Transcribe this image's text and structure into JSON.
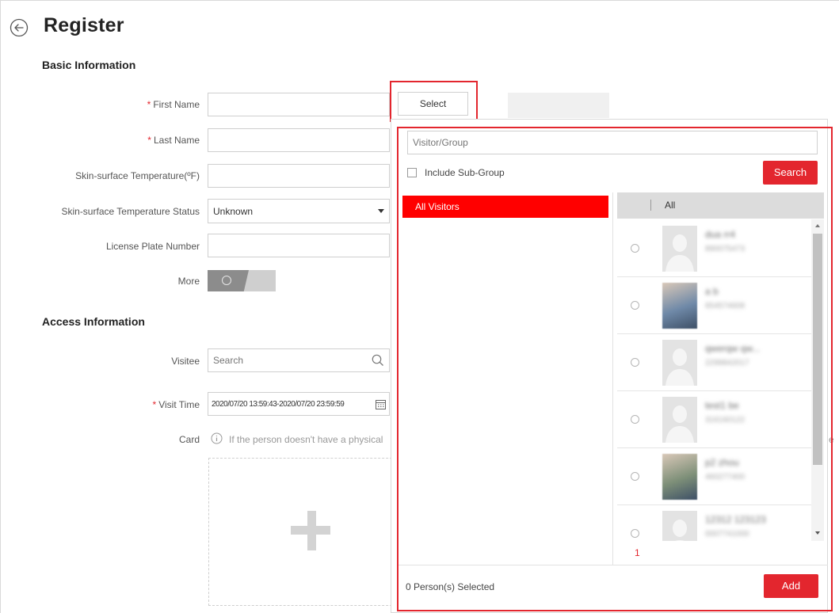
{
  "page": {
    "title": "Register"
  },
  "sections": {
    "basic": "Basic Information",
    "access": "Access Information"
  },
  "form": {
    "first_name_label": "First Name",
    "last_name_label": "Last Name",
    "skin_temp_label": "Skin-surface Temperature(ºF)",
    "skin_status_label": "Skin-surface Temperature Status",
    "skin_status_value": "Unknown",
    "plate_label": "License Plate Number",
    "more_label": "More",
    "visitee_label": "Visitee",
    "visitee_placeholder": "Search",
    "visit_time_label": "Visit Time",
    "visit_time_value": "2020/07/20 13:59:43-2020/07/20 23:59:59",
    "card_label": "Card",
    "card_hint": "If the person doesn't have a physical",
    "card_hint_tail": "e"
  },
  "select_button": "Select",
  "picker": {
    "search_placeholder": "Visitor/Group",
    "include_sub_group": "Include Sub-Group",
    "search_button": "Search",
    "tree_items": [
      "All Visitors"
    ],
    "list_header": "All",
    "persons": [
      {
        "name": "dua rr4",
        "id": "890075473",
        "photo": false
      },
      {
        "name": "a b",
        "id": "654574608",
        "photo": true,
        "tone": "#6f89a8"
      },
      {
        "name": "qwerqw qw...",
        "id": "2299842017",
        "photo": false
      },
      {
        "name": "test1 be",
        "id": "316160122",
        "photo": false
      },
      {
        "name": "p2 zhou",
        "id": "460277400",
        "photo": true,
        "tone": "#7d8f78"
      },
      {
        "name": "12312 123123",
        "id": "0007741000",
        "photo": false
      }
    ],
    "page_number": "1",
    "selected_count": "0 Person(s) Selected",
    "add_button": "Add"
  },
  "colors": {
    "accent": "#e3262e",
    "tree_selected": "#ff0000"
  }
}
